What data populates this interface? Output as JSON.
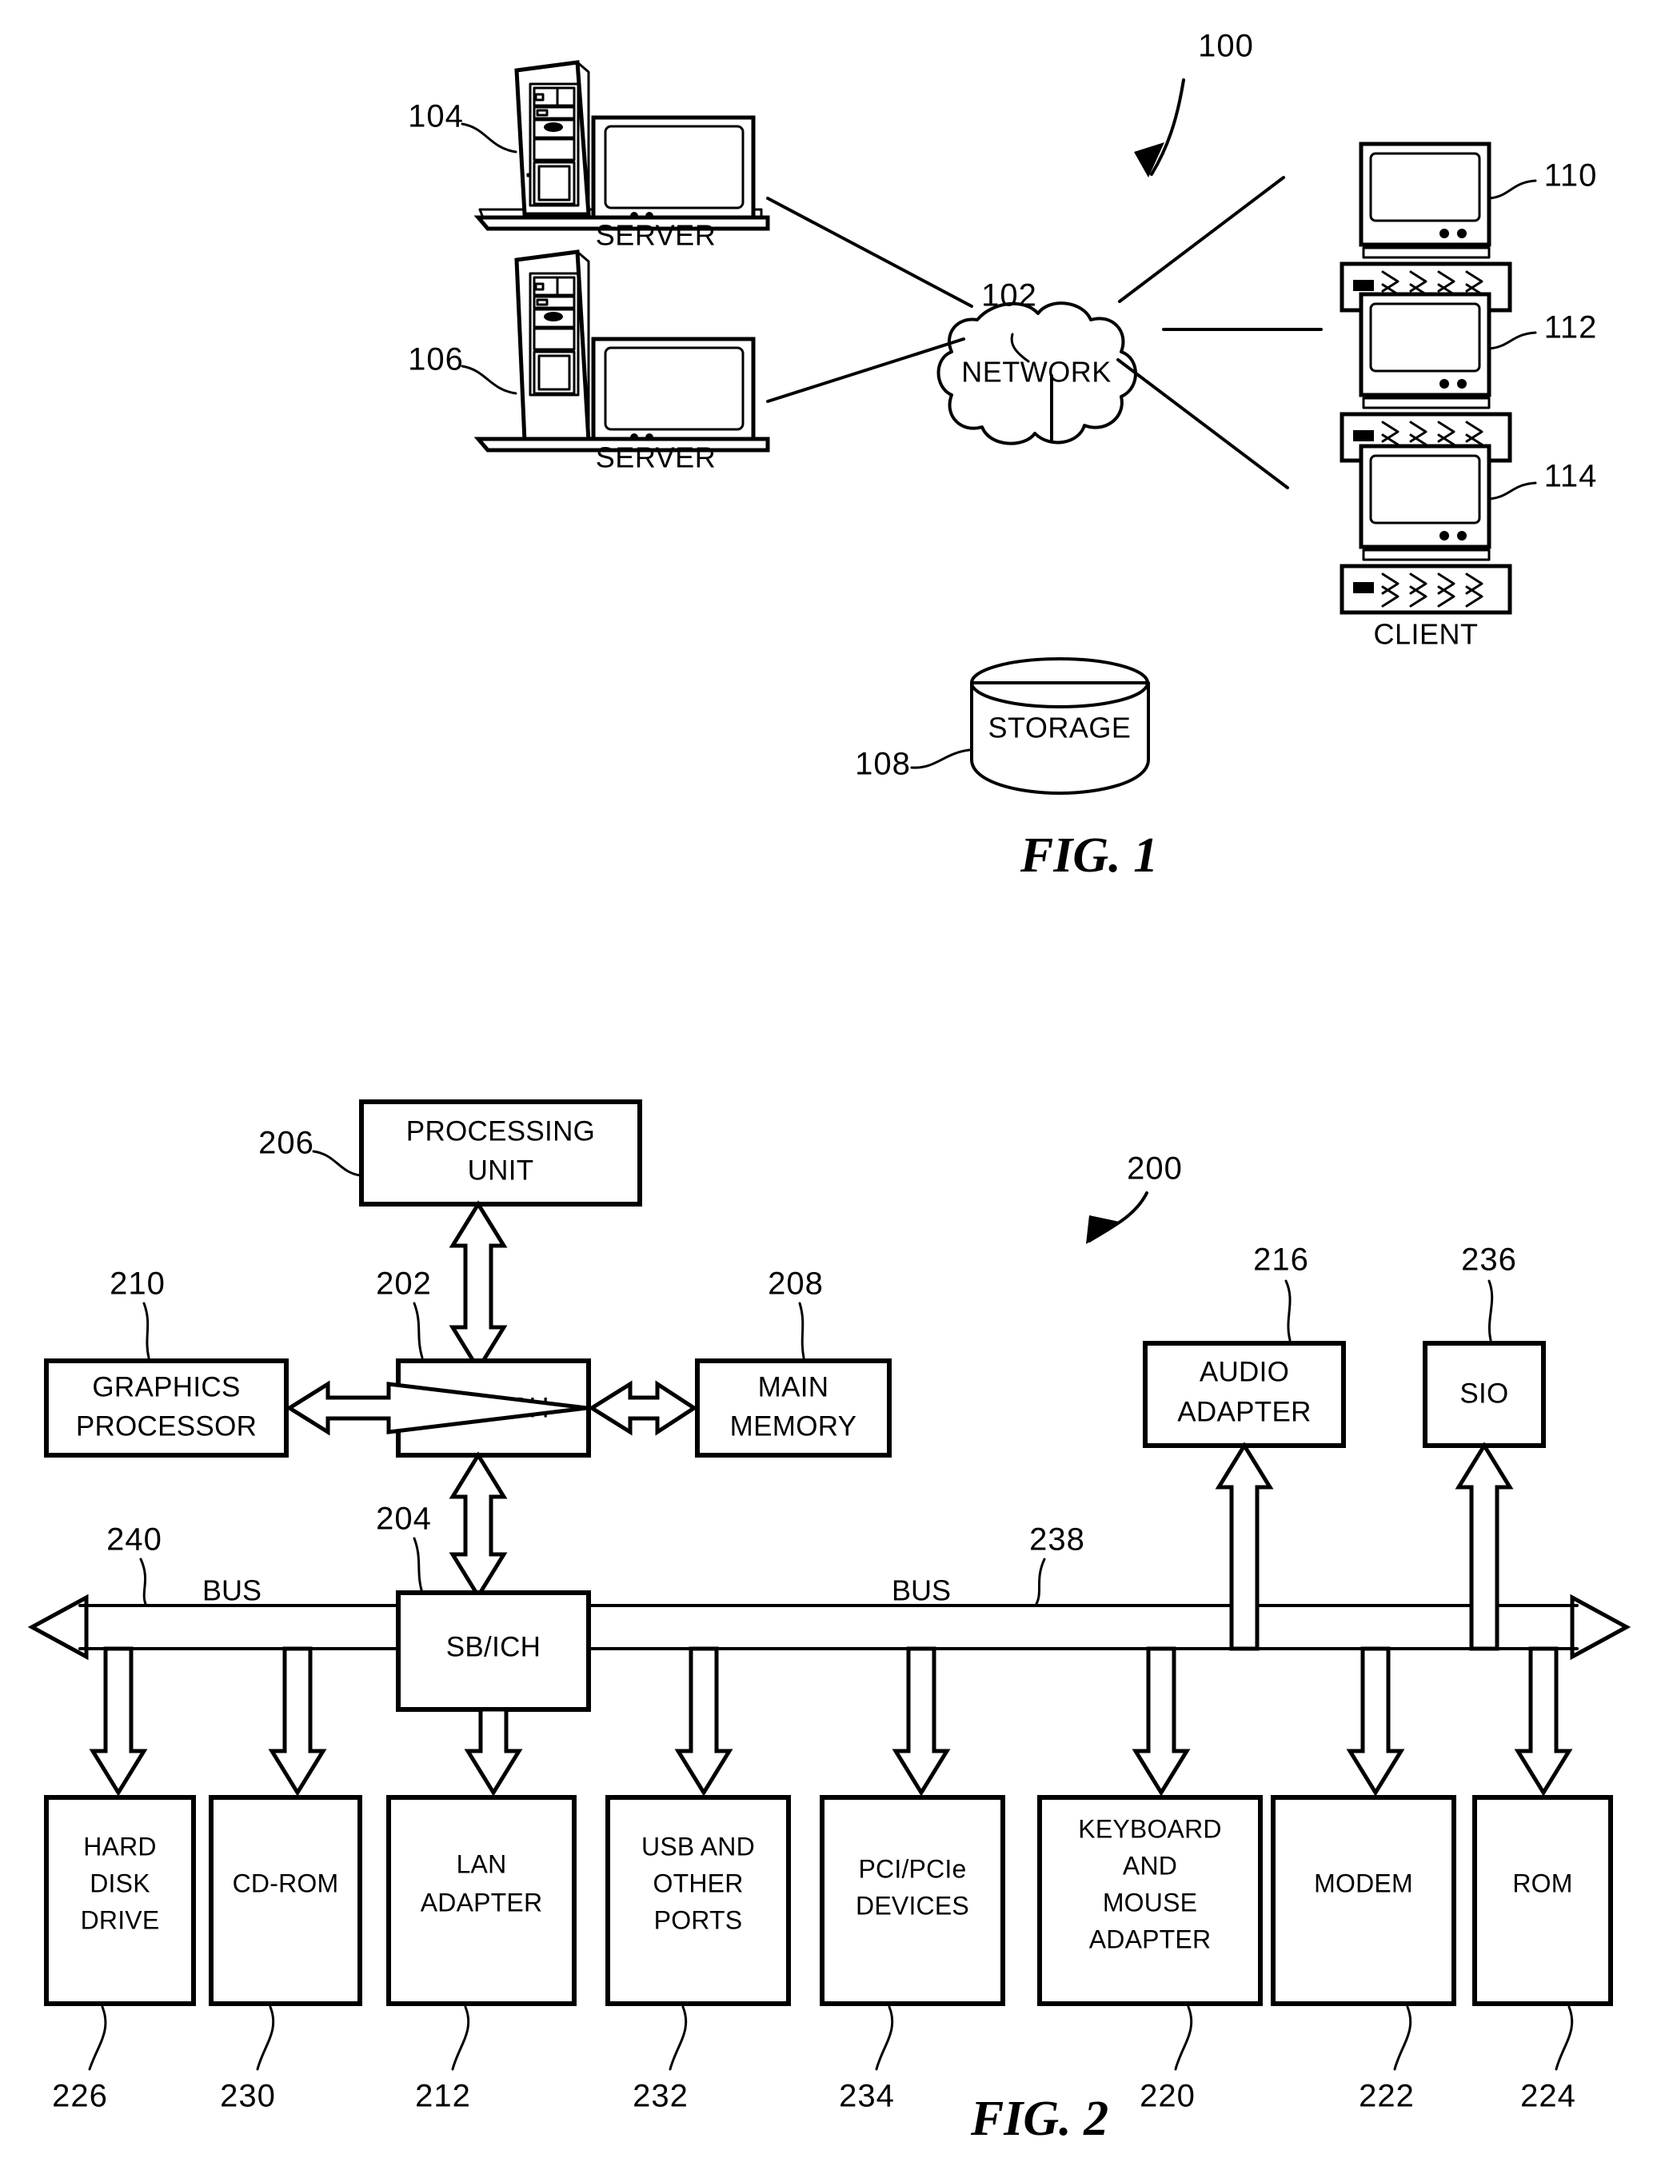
{
  "document": {
    "kind": "patent-drawing-sheet",
    "ink_color": "#000000",
    "paper_color": "#ffffff"
  },
  "fig1": {
    "caption": "FIG. 1",
    "system_ref": "100",
    "network": {
      "ref": "102",
      "label": "NETWORK"
    },
    "storage": {
      "ref": "108",
      "label": "STORAGE"
    },
    "servers": [
      {
        "ref": "104",
        "label": "SERVER"
      },
      {
        "ref": "106",
        "label": "SERVER"
      }
    ],
    "clients": [
      {
        "ref": "110",
        "label": "CLIENT"
      },
      {
        "ref": "112",
        "label": "CLIENT"
      },
      {
        "ref": "114",
        "label": "CLIENT"
      }
    ]
  },
  "fig2": {
    "caption": "FIG. 2",
    "system_ref": "200",
    "bus_label_left": "BUS",
    "bus_label_right": "BUS",
    "bus_ref_left": "240",
    "bus_ref_right": "238",
    "processing_unit": {
      "ref": "206",
      "lines": [
        "PROCESSING",
        "UNIT"
      ]
    },
    "north_bridge": {
      "ref": "202",
      "lines": [
        "NB/MCH"
      ]
    },
    "south_bridge": {
      "ref": "204",
      "lines": [
        "SB/ICH"
      ]
    },
    "graphics": {
      "ref": "210",
      "lines": [
        "GRAPHICS",
        "PROCESSOR"
      ]
    },
    "main_memory": {
      "ref": "208",
      "lines": [
        "MAIN",
        "MEMORY"
      ]
    },
    "audio_adapter": {
      "ref": "216",
      "lines": [
        "AUDIO",
        "ADAPTER"
      ]
    },
    "sio": {
      "ref": "236",
      "lines": [
        "SIO"
      ]
    },
    "peripherals": [
      {
        "ref": "226",
        "lines": [
          "HARD",
          "DISK",
          "DRIVE"
        ]
      },
      {
        "ref": "230",
        "lines": [
          "CD-ROM"
        ]
      },
      {
        "ref": "212",
        "lines": [
          "LAN",
          "ADAPTER"
        ]
      },
      {
        "ref": "232",
        "lines": [
          "USB AND",
          "OTHER",
          "PORTS"
        ]
      },
      {
        "ref": "234",
        "lines": [
          "PCI/PCIe",
          "DEVICES"
        ]
      },
      {
        "ref": "220",
        "lines": [
          "KEYBOARD",
          "AND",
          "MOUSE",
          "ADAPTER"
        ]
      },
      {
        "ref": "222",
        "lines": [
          "MODEM"
        ]
      },
      {
        "ref": "224",
        "lines": [
          "ROM"
        ]
      }
    ]
  }
}
